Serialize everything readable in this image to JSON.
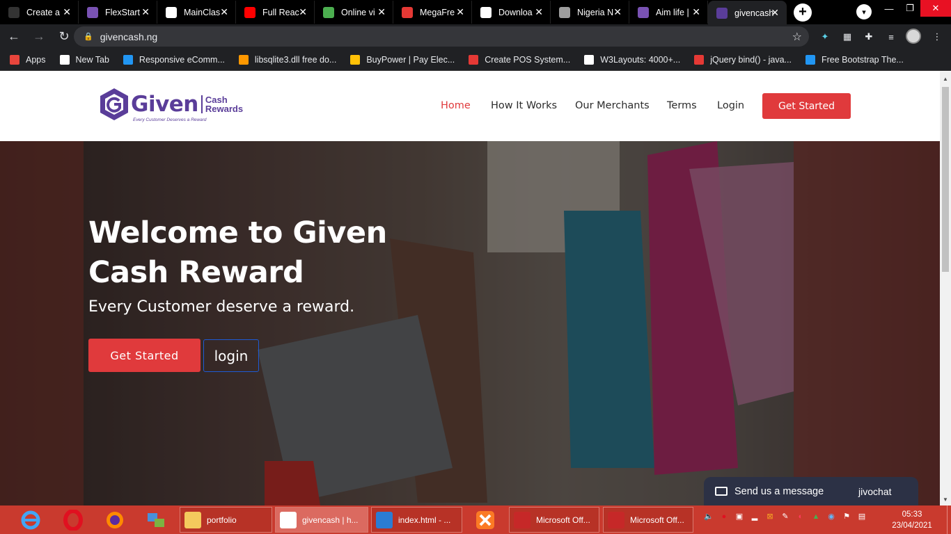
{
  "browser": {
    "tabs": [
      {
        "title": "Create a",
        "fav": "github-icon",
        "color": "#333333"
      },
      {
        "title": "FlexStart",
        "fav": "bootstrap-icon",
        "color": "#7952b3"
      },
      {
        "title": "MainClas",
        "fav": "shield-icon",
        "color": "#ffffff"
      },
      {
        "title": "Full Reac",
        "fav": "youtube-icon",
        "color": "#ff0000"
      },
      {
        "title": "Online vi",
        "fav": "download-arrow-icon",
        "color": "#4caf50"
      },
      {
        "title": "MegaFre",
        "fav": "megafree-icon",
        "color": "#e53935"
      },
      {
        "title": "Downloa",
        "fav": "download-icon",
        "color": "#ffffff"
      },
      {
        "title": "Nigeria N",
        "fav": "document-icon",
        "color": "#9e9e9e"
      },
      {
        "title": "Aim life |",
        "fav": "bootstrap-icon",
        "color": "#7952b3"
      },
      {
        "title": "givencash",
        "fav": "givencash-icon",
        "color": "#5a3d99"
      }
    ],
    "url": "givencash.ng",
    "bookmarks": [
      {
        "label": "Apps",
        "color": "#e8453c"
      },
      {
        "label": "New Tab",
        "color": "#ffffff"
      },
      {
        "label": "Responsive eComm...",
        "color": "#2196f3"
      },
      {
        "label": "libsqlite3.dll free do...",
        "color": "#ff9800"
      },
      {
        "label": "BuyPower | Pay Elec...",
        "color": "#ffc107"
      },
      {
        "label": "Create POS System...",
        "color": "#e53935"
      },
      {
        "label": "W3Layouts: 4000+...",
        "color": "#ffffff"
      },
      {
        "label": "jQuery bind() - java...",
        "color": "#e53935"
      },
      {
        "label": "Free Bootstrap The...",
        "color": "#2196f3"
      }
    ]
  },
  "site": {
    "logo": {
      "word": "Given",
      "cash": "Cash",
      "rewards": "Rewards",
      "tagline": "Every Customer Deserves a Reward",
      "color": "#5a3d99"
    },
    "nav": [
      {
        "label": "Home",
        "active": true
      },
      {
        "label": "How It Works",
        "active": false
      },
      {
        "label": "Our Merchants",
        "active": false
      },
      {
        "label": "Terms",
        "active": false
      },
      {
        "label": "Login",
        "active": false
      }
    ],
    "nav_cta": "Get Started",
    "accent": "#e03a3c",
    "hero": {
      "title_line1": "Welcome to Given",
      "title_line2": "Cash Reward",
      "subtitle": "Every Customer deserve a reward.",
      "primary_button": "Get Started",
      "secondary_button": "login"
    },
    "chat": {
      "label": "Send us a message",
      "brand": "jivochat"
    }
  },
  "taskbar": {
    "apps": [
      {
        "label": "portfolio",
        "active": false
      },
      {
        "label": "givencash | h...",
        "active": true
      },
      {
        "label": "index.html - ...",
        "active": false
      },
      {
        "label": "Microsoft Off...",
        "active": false
      },
      {
        "label": "Microsoft Off...",
        "active": false
      }
    ],
    "time": "05:33",
    "date": "23/04/2021"
  }
}
